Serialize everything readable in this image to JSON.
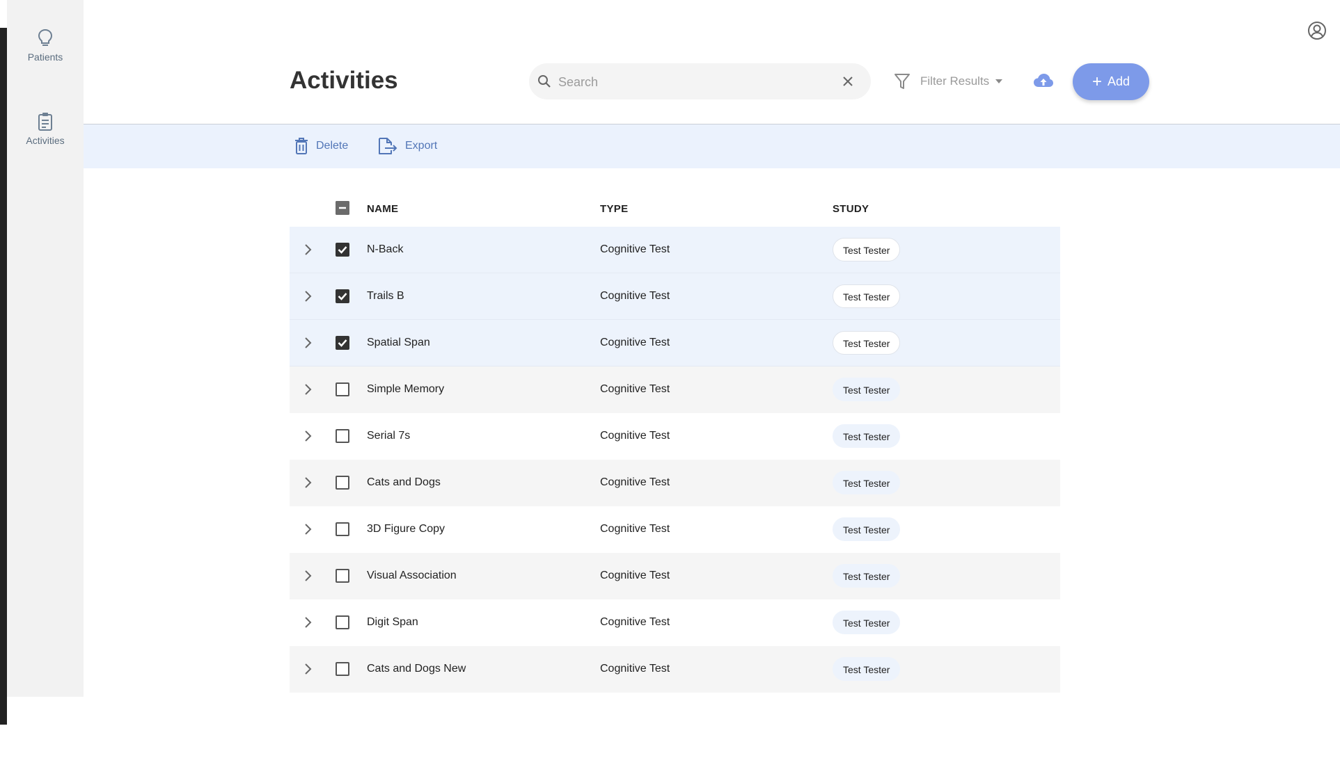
{
  "sidebar": {
    "items": [
      {
        "label": "Patients",
        "icon": "lightbulb-icon"
      },
      {
        "label": "Activities",
        "icon": "clipboard-icon"
      }
    ]
  },
  "header": {
    "title": "Activities",
    "search": {
      "placeholder": "Search",
      "value": ""
    },
    "filter_label": "Filter Results",
    "add_label": "Add"
  },
  "toolbar": {
    "delete_label": "Delete",
    "export_label": "Export"
  },
  "table": {
    "columns": [
      "NAME",
      "TYPE",
      "STUDY"
    ],
    "rows": [
      {
        "name": "N-Back",
        "type": "Cognitive Test",
        "study": "Test Tester",
        "checked": true
      },
      {
        "name": "Trails B",
        "type": "Cognitive Test",
        "study": "Test Tester",
        "checked": true
      },
      {
        "name": "Spatial Span",
        "type": "Cognitive Test",
        "study": "Test Tester",
        "checked": true
      },
      {
        "name": "Simple Memory",
        "type": "Cognitive Test",
        "study": "Test Tester",
        "checked": false
      },
      {
        "name": "Serial 7s",
        "type": "Cognitive Test",
        "study": "Test Tester",
        "checked": false
      },
      {
        "name": "Cats and Dogs",
        "type": "Cognitive Test",
        "study": "Test Tester",
        "checked": false
      },
      {
        "name": "3D Figure Copy",
        "type": "Cognitive Test",
        "study": "Test Tester",
        "checked": false
      },
      {
        "name": "Visual Association",
        "type": "Cognitive Test",
        "study": "Test Tester",
        "checked": false
      },
      {
        "name": "Digit Span",
        "type": "Cognitive Test",
        "study": "Test Tester",
        "checked": false
      },
      {
        "name": "Cats and Dogs New",
        "type": "Cognitive Test",
        "study": "Test Tester",
        "checked": false
      }
    ]
  },
  "colors": {
    "accent": "#7d9ae9",
    "toolbar_bg": "#ebf2fd",
    "selected_row": "#edf3fc",
    "sidebar_bg": "#f2f2f2"
  }
}
